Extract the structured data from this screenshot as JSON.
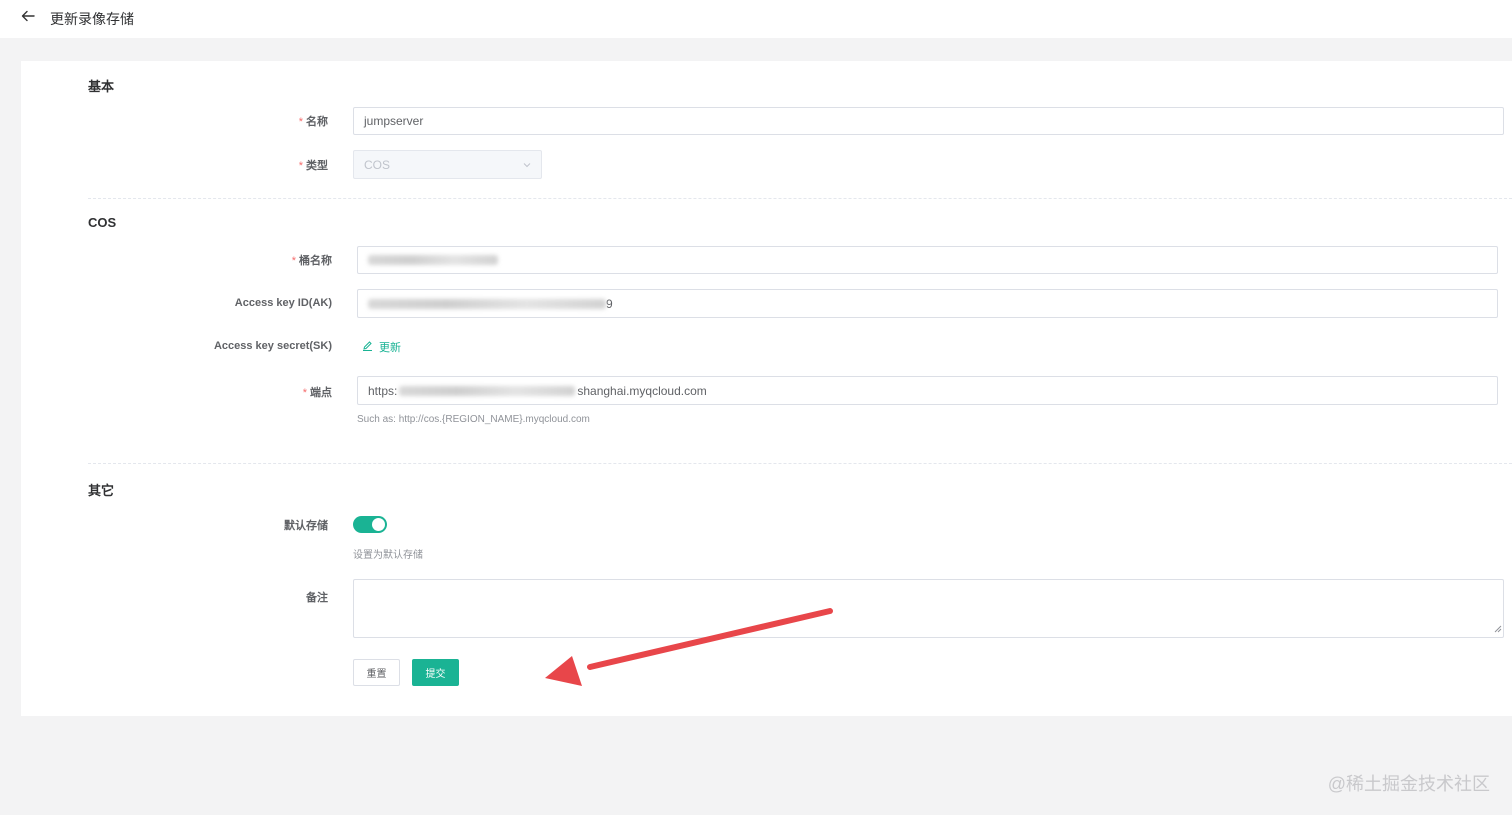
{
  "header": {
    "title": "更新录像存储",
    "back_icon": "arrow-left-icon"
  },
  "sections": {
    "basic": "基本",
    "cos": "COS",
    "other": "其它"
  },
  "fields": {
    "name": {
      "label": "名称",
      "value": "jumpserver"
    },
    "type": {
      "label": "类型",
      "value": "COS"
    },
    "bucket": {
      "label": "桶名称",
      "value": ""
    },
    "access_key_id": {
      "label": "Access key ID(AK)",
      "value_suffix": "9"
    },
    "access_key_secret": {
      "label": "Access key secret(SK)",
      "action": "更新"
    },
    "endpoint": {
      "label": "端点",
      "value_prefix": "https:",
      "value_suffix": "shanghai.myqcloud.com",
      "help": "Such as: http://cos.{REGION_NAME}.myqcloud.com"
    },
    "default_storage": {
      "label": "默认存储",
      "enabled": true,
      "help": "设置为默认存储"
    },
    "comment": {
      "label": "备注",
      "value": ""
    }
  },
  "buttons": {
    "reset": "重置",
    "submit": "提交"
  },
  "watermark": "@稀土掘金技术社区",
  "colors": {
    "accent": "#1ab394",
    "required": "#f56c6c",
    "annotation_arrow": "#e8464a"
  }
}
